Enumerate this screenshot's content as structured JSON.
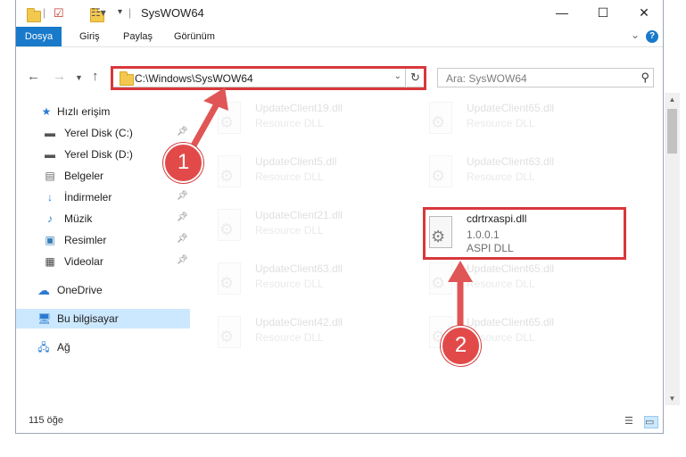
{
  "window": {
    "title": "SysWOW64",
    "controls": {
      "minimize": "—",
      "maximize": "☐",
      "close": "✕"
    }
  },
  "ribbon": {
    "tabs": [
      "Dosya",
      "Giriş",
      "Paylaş",
      "Görünüm"
    ],
    "expand_icon": "chevron-down-icon",
    "help_label": "?"
  },
  "address": {
    "path": "C:\\Windows\\SysWOW64",
    "refresh_glyph": "↻",
    "dropdown_glyph": "⌄"
  },
  "search": {
    "placeholder": "Ara: SysWOW64",
    "icon": "search-icon"
  },
  "sidebar": {
    "quick_access": "Hızlı erişim",
    "items": [
      {
        "label": "Yerel Disk (C:)",
        "icon": "drive-icon",
        "pinned": true
      },
      {
        "label": "Yerel Disk (D:)",
        "icon": "drive-icon",
        "pinned": true
      },
      {
        "label": "Belgeler",
        "icon": "documents-icon",
        "pinned": true
      },
      {
        "label": "İndirmeler",
        "icon": "downloads-icon",
        "pinned": true
      },
      {
        "label": "Müzik",
        "icon": "music-icon",
        "pinned": true
      },
      {
        "label": "Resimler",
        "icon": "pictures-icon",
        "pinned": true
      },
      {
        "label": "Videolar",
        "icon": "videos-icon",
        "pinned": true
      }
    ],
    "onedrive": "OneDrive",
    "this_pc": "Bu bilgisayar",
    "network": "Ağ"
  },
  "files": {
    "left_column": [
      {
        "name": "UpdateClient19.dll",
        "type": "Resource DLL"
      },
      {
        "name": "UpdateClient5.dll",
        "type": "Resource DLL"
      },
      {
        "name": "UpdateClient21.dll",
        "type": "Resource DLL"
      },
      {
        "name": "UpdateClient63.dll",
        "type": "Resource DLL"
      },
      {
        "name": "UpdateClient42.dll",
        "type": "Resource DLL"
      }
    ],
    "right_column": [
      {
        "name": "UpdateClient65.dll",
        "type": "Resource DLL"
      },
      {
        "name": "UpdateClient63.dll",
        "type": "Resource DLL"
      },
      {
        "name": "cdrtrxaspi.dll",
        "version": "1.0.0.1",
        "type": "ASPI DLL",
        "highlighted": true
      },
      {
        "name": "UpdateClient65.dll",
        "type": "Resource DLL"
      },
      {
        "name": "UpdateClient65.dll",
        "type": "Resource DLL"
      }
    ]
  },
  "status": {
    "count": "115 öğe"
  },
  "annotations": {
    "badge1": "1",
    "badge2": "2",
    "color": "#d8383c"
  },
  "colors": {
    "accent": "#1979ca",
    "selection": "#cce8ff"
  }
}
